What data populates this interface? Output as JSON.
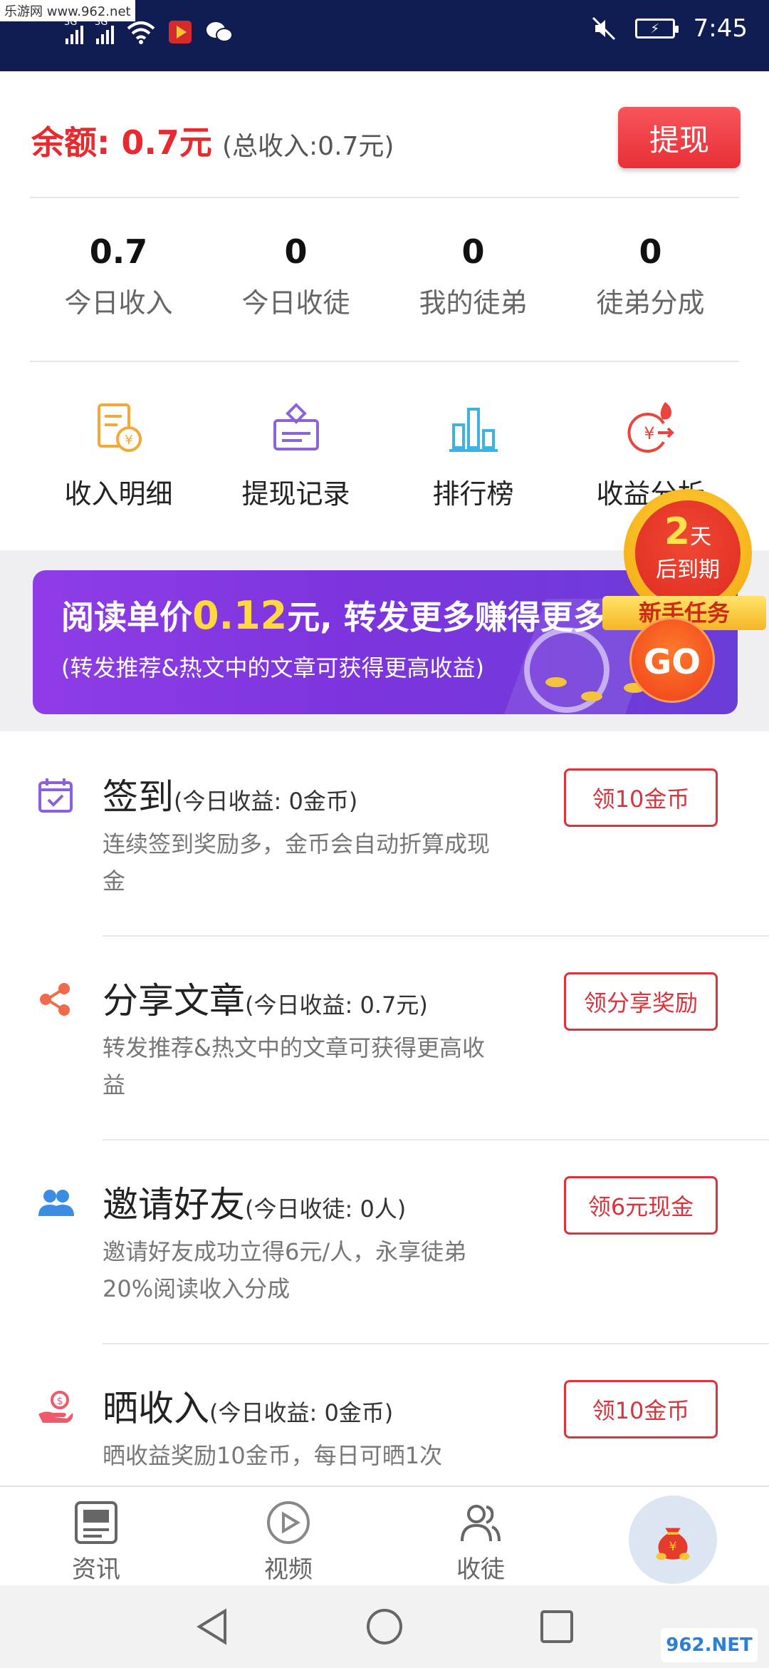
{
  "status_bar": {
    "watermark": "乐游网 www.962.net",
    "net1": "3G",
    "net2": "3G",
    "time": "7:45"
  },
  "balance": {
    "label": "余额: 0.7元",
    "total": "(总收入:0.7元)",
    "withdraw_button": "提现"
  },
  "stats": [
    {
      "value": "0.7",
      "label": "今日收入"
    },
    {
      "value": "0",
      "label": "今日收徒"
    },
    {
      "value": "0",
      "label": "我的徒弟"
    },
    {
      "value": "0",
      "label": "徒弟分成"
    }
  ],
  "quick_links": [
    {
      "label": "收入明细",
      "icon": "income-detail-icon"
    },
    {
      "label": "提现记录",
      "icon": "withdraw-record-icon"
    },
    {
      "label": "排行榜",
      "icon": "ranking-icon"
    },
    {
      "label": "收益分析",
      "icon": "earnings-analysis-icon"
    }
  ],
  "banner": {
    "line1_prefix": "阅读单价",
    "line1_highlight": "0.12",
    "line1_suffix": "元, 转发更多赚得更多",
    "line2": "(转发推荐&热文中的文章可获得更高收益)",
    "badge_days_num": "2",
    "badge_days_unit": "天",
    "badge_expire": "后到期",
    "badge_ribbon": "新手任务",
    "go_button": "GO"
  },
  "tasks": [
    {
      "title": "签到",
      "subtitle": "(今日收益: 0金币)",
      "desc": "连续签到奖励多，金币会自动折算成现金",
      "button": "领10金币",
      "icon": "calendar-check-icon"
    },
    {
      "title": "分享文章",
      "subtitle": "(今日收益: 0.7元)",
      "desc": "转发推荐&热文中的文章可获得更高收益",
      "button": "领分享奖励",
      "icon": "share-icon"
    },
    {
      "title": "邀请好友",
      "subtitle": "(今日收徒: 0人)",
      "desc": "邀请好友成功立得6元/人，永享徒弟20%阅读收入分成",
      "button": "领6元现金",
      "icon": "invite-friends-icon"
    },
    {
      "title": "晒收入",
      "subtitle": "(今日收益: 0金币)",
      "desc": "晒收益奖励10金币，每日可晒1次",
      "button": "领10金币",
      "icon": "hand-coin-icon"
    }
  ],
  "bottom_nav": [
    {
      "label": "资讯",
      "icon": "news-icon"
    },
    {
      "label": "视频",
      "icon": "video-icon"
    },
    {
      "label": "收徒",
      "icon": "apprentice-icon"
    },
    {
      "label": "",
      "icon": "money-bag-icon"
    }
  ],
  "corner_watermark": "962.NET",
  "colors": {
    "status_bar": "#0f1d52",
    "accent_red": "#e8292e",
    "banner_purple": "#8f3de6",
    "highlight_yellow": "#ffd83b"
  }
}
